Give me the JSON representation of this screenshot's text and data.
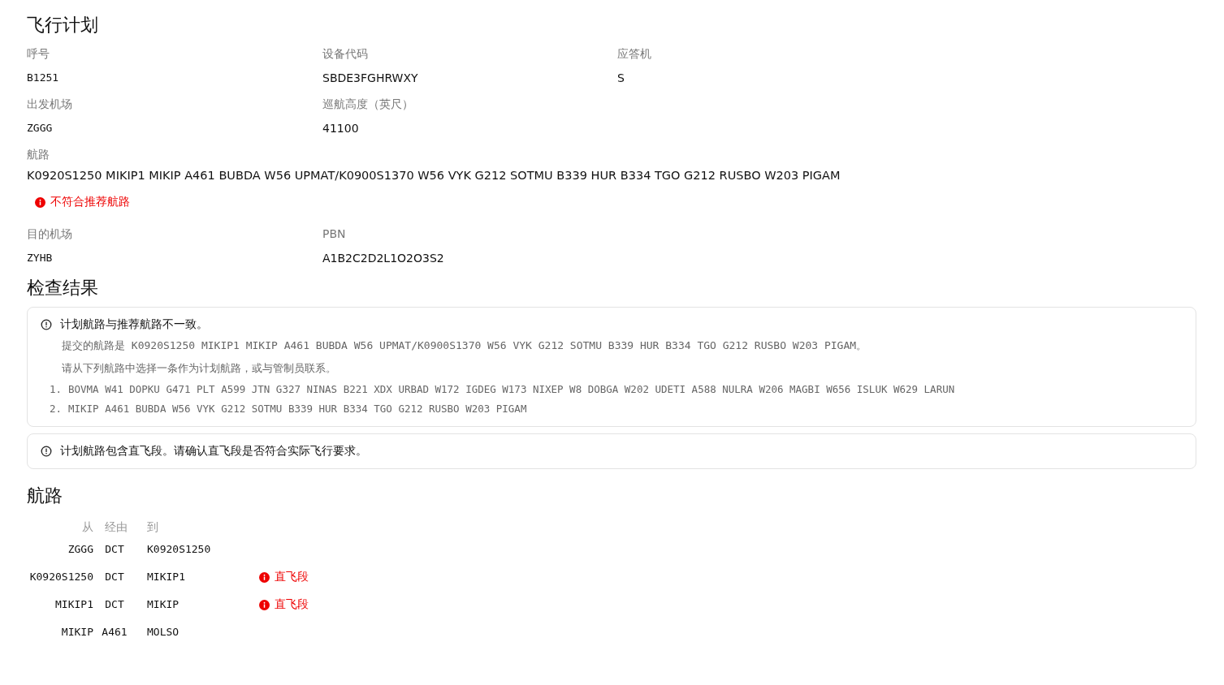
{
  "flight_plan": {
    "title": "飞行计划",
    "rows": [
      [
        {
          "label": "呼号",
          "value": "B1251",
          "kind": "code"
        },
        {
          "label": "设备代码",
          "value": "SBDE3FGHRWXY",
          "kind": "text"
        },
        {
          "label": "应答机",
          "value": "S",
          "kind": "text"
        }
      ],
      [
        {
          "label": "出发机场",
          "value": "ZGGG",
          "kind": "code"
        },
        {
          "label": "巡航高度（英尺）",
          "value": "41100",
          "kind": "text"
        }
      ]
    ],
    "route": {
      "label": "航路",
      "value": "K0920S1250 MIKIP1 MIKIP A461 BUBDA W56 UPMAT/K0900S1370 W56 VYK G212 SOTMU B339 HUR B334 TGO G212 RUSBO W203 PIGAM",
      "error": "不符合推荐航路"
    },
    "rows_after": [
      [
        {
          "label": "目的机场",
          "value": "ZYHB",
          "kind": "code"
        },
        {
          "label": "PBN",
          "value": "A1B2C2D2L1O2O3S2",
          "kind": "text"
        }
      ]
    ]
  },
  "check_results": {
    "title": "检查结果",
    "alerts": [
      {
        "message": "计划航路与推荐航路不一致。",
        "details": [
          "提交的航路是 K0920S1250 MIKIP1 MIKIP A461 BUBDA W56 UPMAT/K0900S1370 W56 VYK G212 SOTMU B339 HUR B334 TGO G212 RUSBO W203 PIGAM。",
          "请从下列航路中选择一条作为计划航路，或与管制员联系。"
        ],
        "options": [
          {
            "number": "1.",
            "route": "BOVMA W41 DOPKU G471 PLT A599 JTN G327 NINAS B221 XDX URBAD W172 IGDEG W173 NIXEP W8 DOBGA W202 UDETI A588 NULRA W206 MAGBI W656 ISLUK W629 LARUN"
          },
          {
            "number": "2.",
            "route": "MIKIP A461 BUBDA W56 VYK G212 SOTMU B339 HUR B334 TGO G212 RUSBO W203 PIGAM"
          }
        ]
      },
      {
        "message": "计划航路包含直飞段。请确认直飞段是否符合实际飞行要求。"
      }
    ]
  },
  "route_table": {
    "title": "航路",
    "columns": [
      "从",
      "经由",
      "到"
    ],
    "rows": [
      {
        "from": "ZGGG",
        "via": "DCT",
        "to": "K0920S1250"
      },
      {
        "from": "K0920S1250",
        "via": "DCT",
        "to": "MIKIP1",
        "warning": "直飞段"
      },
      {
        "from": "MIKIP1",
        "via": "DCT",
        "to": "MIKIP",
        "warning": "直飞段"
      },
      {
        "from": "MIKIP",
        "via": "A461",
        "to": "MOLSO"
      }
    ]
  }
}
